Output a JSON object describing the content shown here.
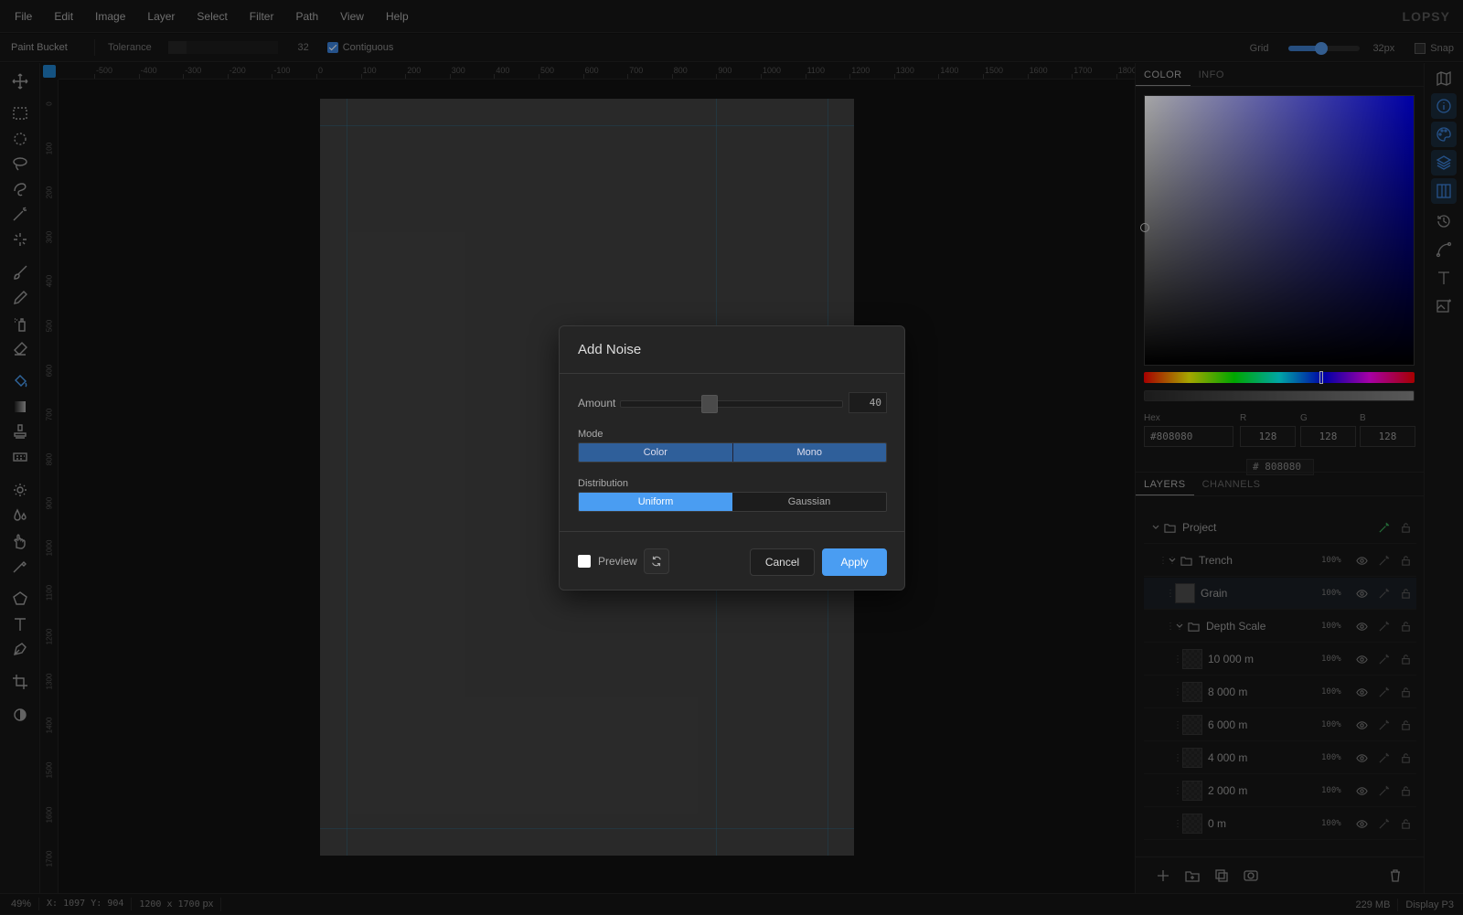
{
  "menubar": {
    "items": [
      "File",
      "Edit",
      "Image",
      "Layer",
      "Select",
      "Filter",
      "Path",
      "View",
      "Help"
    ],
    "brand": "LOPSY"
  },
  "options": {
    "tool_name": "Paint Bucket",
    "tolerance_label": "Tolerance",
    "tolerance_value": "32",
    "contiguous_label": "Contiguous",
    "contiguous_checked": true,
    "grid_label": "Grid",
    "grid_value": "32px",
    "grid_slider_fraction": 0.45,
    "snap_label": "Snap",
    "snap_checked": false
  },
  "ruler": {
    "top_labels": [
      "-500",
      "-400",
      "-300",
      "-200",
      "-100",
      "0",
      "100",
      "200",
      "300",
      "400",
      "500",
      "600",
      "700",
      "800",
      "900",
      "1000",
      "1100",
      "1200",
      "1300",
      "1400",
      "1500",
      "1600",
      "1700",
      "1800"
    ],
    "left_labels": [
      "0",
      "100",
      "200",
      "300",
      "400",
      "500",
      "600",
      "700",
      "800",
      "900",
      "1000",
      "1100",
      "1200",
      "1300",
      "1400",
      "1500",
      "1600",
      "1700"
    ]
  },
  "tools": [
    "move-icon",
    "rect-select-icon",
    "ellipse-select-icon",
    "lasso-icon",
    "magnetic-lasso-icon",
    "magic-wand-icon",
    "quick-select-icon",
    "brush-icon",
    "pencil-icon",
    "spray-icon",
    "eraser-icon",
    "paint-bucket-icon",
    "gradient-icon",
    "stamp-icon",
    "pattern-icon",
    "dodge-icon",
    "blur-icon",
    "smudge-icon",
    "eyedropper-icon",
    "polygon-icon",
    "text-icon",
    "pen-icon",
    "crop-icon",
    "contrast-icon"
  ],
  "active_tool": "paint-bucket-icon",
  "color_panel": {
    "tabs": [
      "COLOR",
      "INFO"
    ],
    "active_tab": "COLOR",
    "hex_label": "Hex",
    "hex_value": "#808080",
    "r_label": "R",
    "r_value": "128",
    "g_label": "G",
    "g_value": "128",
    "b_label": "B",
    "b_value": "128",
    "hash": "#",
    "hex_short": "808080"
  },
  "layers_panel": {
    "tabs": [
      "LAYERS",
      "CHANNELS"
    ],
    "active_tab": "LAYERS",
    "rows": [
      {
        "name": "Project",
        "opacity": "",
        "type": "group",
        "indent": 0
      },
      {
        "name": "Trench",
        "opacity": "100%",
        "type": "group",
        "indent": 1
      },
      {
        "name": "Grain",
        "opacity": "100%",
        "type": "layer",
        "indent": 2,
        "selected": true
      },
      {
        "name": "Depth Scale",
        "opacity": "100%",
        "type": "group",
        "indent": 2
      },
      {
        "name": "10 000 m",
        "opacity": "100%",
        "type": "layer",
        "indent": 3
      },
      {
        "name": "8 000 m",
        "opacity": "100%",
        "type": "layer",
        "indent": 3
      },
      {
        "name": "6 000 m",
        "opacity": "100%",
        "type": "layer",
        "indent": 3
      },
      {
        "name": "4 000 m",
        "opacity": "100%",
        "type": "layer",
        "indent": 3
      },
      {
        "name": "2 000 m",
        "opacity": "100%",
        "type": "layer",
        "indent": 3
      },
      {
        "name": "0 m",
        "opacity": "100%",
        "type": "layer",
        "indent": 3
      }
    ]
  },
  "dialog": {
    "title": "Add Noise",
    "amount_label": "Amount",
    "amount_value": "40",
    "amount_fraction": 0.4,
    "mode_label": "Mode",
    "mode_options": [
      "Color",
      "Mono"
    ],
    "distribution_label": "Distribution",
    "distribution_options": [
      "Uniform",
      "Gaussian"
    ],
    "distribution_selected": "Uniform",
    "preview_label": "Preview",
    "preview_checked": false,
    "cancel_label": "Cancel",
    "apply_label": "Apply"
  },
  "status": {
    "zoom": "49%",
    "x_label": "X:",
    "x_value": "1097",
    "y_label": "Y:",
    "y_value": "904",
    "doc_size": "1200 x 1700",
    "doc_unit": "px",
    "memory": "229 MB",
    "color_profile": "Display P3"
  }
}
